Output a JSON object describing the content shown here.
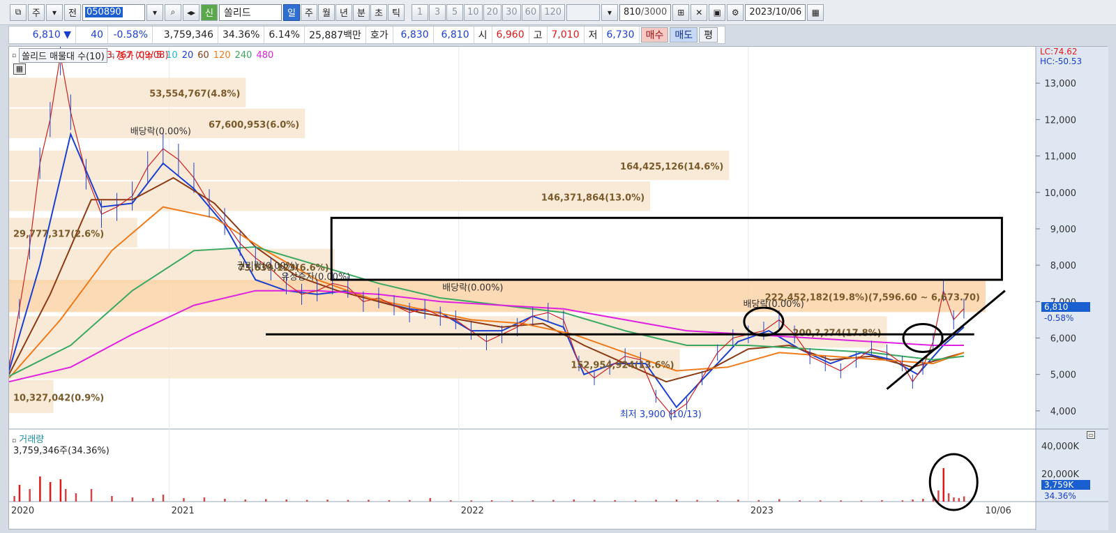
{
  "toolbar": {
    "type_label": "주",
    "prev_label": "전",
    "stock_code": "050890",
    "stock_name": "쏠리드",
    "credit_label": "신",
    "periods": [
      "일",
      "주",
      "월",
      "년",
      "분",
      "초",
      "틱"
    ],
    "selected_period": "일",
    "intervals": [
      "1",
      "3",
      "5",
      "10",
      "20",
      "30",
      "60",
      "120"
    ],
    "count_value": "810",
    "count_total": "/3000",
    "date": "2023/10/06"
  },
  "quote": {
    "price": "6,810",
    "direction": "▼",
    "change": "40",
    "change_rate": "-0.58%",
    "volume": "3,759,346",
    "volume_rate": "34.36%",
    "turnover": "6.14%",
    "amount": "25,887백만",
    "bid_label": "호가",
    "bid1": "6,830",
    "bid2": "6,810",
    "open_label": "시",
    "open": "6,960",
    "high_label": "고",
    "high": "7,010",
    "low_label": "저",
    "low": "6,730",
    "buy_label": "매수",
    "sell_label": "매도",
    "flat_label": "평"
  },
  "legend": {
    "indicator": "쏠리드 매물대 수(10)",
    "ma_label": "종가 지수",
    "periods": [
      {
        "p": "5",
        "color": "#e01818"
      },
      {
        "p": "10",
        "color": "#20b8c8"
      },
      {
        "p": "20",
        "color": "#1a3fd0"
      },
      {
        "p": "60",
        "color": "#8b3a14"
      },
      {
        "p": "120",
        "color": "#f07a18"
      },
      {
        "p": "240",
        "color": "#3aa860"
      },
      {
        "p": "480",
        "color": "#e020e0"
      }
    ]
  },
  "right_labels": {
    "lc": "LC:74.62",
    "hc": "HC:-50.53",
    "current_price": "6,810",
    "current_change": "-0.58%",
    "vol_current": "3,759K",
    "vol_rate": "34.36%"
  },
  "annotations": {
    "high": "최고 13,767 (09/08)",
    "low": "최저 3,900 (10/13)",
    "div1": "배당락(0.00%)",
    "div2": "배당락(0.00%)",
    "div3": "배당락(0.00%)",
    "rights": "권리락(0.00%)",
    "rights_issue": "유상증자(0.00%)"
  },
  "volume_section": {
    "label": "거래량",
    "info": "3,759,346주(34.36%)"
  },
  "chart_data": {
    "type": "bar",
    "title": "",
    "price_axis": {
      "ylim": [
        3500,
        14000
      ],
      "ticks": [
        "13,000",
        "12,000",
        "11,000",
        "10,000",
        "9,000",
        "8,000",
        "7,000",
        "6,000",
        "5,000",
        "4,000"
      ],
      "tick_values": [
        13000,
        12000,
        11000,
        10000,
        9000,
        8000,
        7000,
        6000,
        5000,
        4000
      ]
    },
    "volume_axis": {
      "ticks": [
        "40,000K",
        "20,000K"
      ],
      "tick_values": [
        40000,
        20000
      ]
    },
    "x_ticks": [
      {
        "label": "2020",
        "t": 0.0
      },
      {
        "label": "2021",
        "t": 0.156
      },
      {
        "label": "2022",
        "t": 0.438
      },
      {
        "label": "2023",
        "t": 0.72
      },
      {
        "label": "10/06",
        "t": 0.948
      }
    ],
    "volume_profile": [
      {
        "label": "53,554,767(4.8%)",
        "price_from": 12300,
        "price_to": 13150,
        "amount": 53554767,
        "pct": 4.8
      },
      {
        "label": "67,600,953(6.0%)",
        "price_from": 11450,
        "price_to": 12300,
        "amount": 67600953,
        "pct": 6.0
      },
      {
        "label": "164,425,126(14.6%)",
        "price_from": 10300,
        "price_to": 11150,
        "amount": 164425126,
        "pct": 14.6
      },
      {
        "label": "146,371,864(13.0%)",
        "price_from": 9450,
        "price_to": 10300,
        "amount": 146371864,
        "pct": 13.0
      },
      {
        "label": "29,777,317(2.6%)",
        "price_from": 8450,
        "price_to": 9300,
        "amount": 29777317,
        "pct": 2.6
      },
      {
        "label": "73,639,123(6.6%)",
        "price_from": 7450,
        "price_to": 8450,
        "amount": 73639123,
        "pct": 6.6
      },
      {
        "label": "222,452,182(19.8%)(7,596.60 ~ 6,673.70)",
        "price_from": 6673.7,
        "price_to": 7596.6,
        "amount": 222452182,
        "pct": 19.8,
        "highlight": true
      },
      {
        "label": "200,?,?74(17.8%)",
        "price_from": 5700,
        "price_to": 6600,
        "amount": 200000000,
        "pct": 17.8
      },
      {
        "label": "152,954,924(13.6%)",
        "price_from": 4850,
        "price_to": 5700,
        "amount": 152954924,
        "pct": 13.6
      },
      {
        "label": "10,327,042(0.9%)",
        "price_from": 3900,
        "price_to": 4850,
        "amount": 10327042,
        "pct": 0.9
      }
    ],
    "price_series": [
      [
        0.0,
        5200
      ],
      [
        0.01,
        6800
      ],
      [
        0.02,
        8500
      ],
      [
        0.03,
        10800
      ],
      [
        0.04,
        12000
      ],
      [
        0.05,
        13767
      ],
      [
        0.06,
        12200
      ],
      [
        0.075,
        10500
      ],
      [
        0.09,
        9400
      ],
      [
        0.105,
        9600
      ],
      [
        0.12,
        9900
      ],
      [
        0.135,
        10700
      ],
      [
        0.15,
        11200
      ],
      [
        0.165,
        10900
      ],
      [
        0.18,
        10400
      ],
      [
        0.195,
        9700
      ],
      [
        0.21,
        9200
      ],
      [
        0.225,
        8600
      ],
      [
        0.24,
        8200
      ],
      [
        0.255,
        7900
      ],
      [
        0.27,
        7500
      ],
      [
        0.285,
        7200
      ],
      [
        0.3,
        7300
      ],
      [
        0.315,
        7500
      ],
      [
        0.33,
        7400
      ],
      [
        0.345,
        7000
      ],
      [
        0.36,
        7100
      ],
      [
        0.375,
        6900
      ],
      [
        0.39,
        6700
      ],
      [
        0.405,
        6800
      ],
      [
        0.42,
        6600
      ],
      [
        0.435,
        6500
      ],
      [
        0.45,
        6200
      ],
      [
        0.465,
        5900
      ],
      [
        0.48,
        6100
      ],
      [
        0.495,
        6300
      ],
      [
        0.51,
        6600
      ],
      [
        0.525,
        6700
      ],
      [
        0.54,
        6500
      ],
      [
        0.555,
        5300
      ],
      [
        0.57,
        4900
      ],
      [
        0.585,
        5200
      ],
      [
        0.6,
        5500
      ],
      [
        0.615,
        5400
      ],
      [
        0.63,
        4400
      ],
      [
        0.645,
        3900
      ],
      [
        0.66,
        4200
      ],
      [
        0.675,
        4900
      ],
      [
        0.69,
        5600
      ],
      [
        0.705,
        6000
      ],
      [
        0.72,
        6100
      ],
      [
        0.735,
        6200
      ],
      [
        0.75,
        6500
      ],
      [
        0.765,
        6100
      ],
      [
        0.78,
        5500
      ],
      [
        0.795,
        5300
      ],
      [
        0.81,
        5100
      ],
      [
        0.825,
        5400
      ],
      [
        0.84,
        5700
      ],
      [
        0.855,
        5600
      ],
      [
        0.87,
        5300
      ],
      [
        0.88,
        4800
      ],
      [
        0.89,
        5200
      ],
      [
        0.9,
        5900
      ],
      [
        0.91,
        7300
      ],
      [
        0.92,
        6500
      ],
      [
        0.93,
        6810
      ]
    ],
    "ma_series": [
      {
        "name": "20",
        "color": "#1a3fd0",
        "points": [
          [
            0.0,
            5100
          ],
          [
            0.03,
            8000
          ],
          [
            0.06,
            11600
          ],
          [
            0.09,
            9600
          ],
          [
            0.12,
            9700
          ],
          [
            0.15,
            10800
          ],
          [
            0.18,
            10100
          ],
          [
            0.21,
            9100
          ],
          [
            0.24,
            7600
          ],
          [
            0.27,
            7300
          ],
          [
            0.3,
            7200
          ],
          [
            0.33,
            7300
          ],
          [
            0.36,
            7000
          ],
          [
            0.39,
            6800
          ],
          [
            0.42,
            6700
          ],
          [
            0.45,
            6200
          ],
          [
            0.48,
            6200
          ],
          [
            0.51,
            6600
          ],
          [
            0.54,
            6300
          ],
          [
            0.56,
            5000
          ],
          [
            0.59,
            5300
          ],
          [
            0.62,
            5300
          ],
          [
            0.65,
            4100
          ],
          [
            0.68,
            5000
          ],
          [
            0.71,
            5900
          ],
          [
            0.74,
            6200
          ],
          [
            0.77,
            5700
          ],
          [
            0.8,
            5300
          ],
          [
            0.83,
            5600
          ],
          [
            0.86,
            5400
          ],
          [
            0.885,
            5000
          ],
          [
            0.91,
            5800
          ],
          [
            0.93,
            6300
          ]
        ]
      },
      {
        "name": "60",
        "color": "#8b3a14",
        "points": [
          [
            0.0,
            5000
          ],
          [
            0.04,
            7200
          ],
          [
            0.08,
            9800
          ],
          [
            0.12,
            9800
          ],
          [
            0.16,
            10400
          ],
          [
            0.2,
            9700
          ],
          [
            0.24,
            8500
          ],
          [
            0.28,
            7700
          ],
          [
            0.32,
            7300
          ],
          [
            0.36,
            7000
          ],
          [
            0.4,
            6700
          ],
          [
            0.44,
            6500
          ],
          [
            0.48,
            6300
          ],
          [
            0.52,
            6400
          ],
          [
            0.56,
            5800
          ],
          [
            0.6,
            5300
          ],
          [
            0.64,
            4800
          ],
          [
            0.68,
            5100
          ],
          [
            0.72,
            5700
          ],
          [
            0.76,
            5800
          ],
          [
            0.8,
            5400
          ],
          [
            0.84,
            5500
          ],
          [
            0.88,
            5200
          ],
          [
            0.93,
            5600
          ]
        ]
      },
      {
        "name": "120",
        "color": "#f07a18",
        "points": [
          [
            0.0,
            4900
          ],
          [
            0.05,
            6500
          ],
          [
            0.1,
            8400
          ],
          [
            0.15,
            9600
          ],
          [
            0.2,
            9300
          ],
          [
            0.25,
            8400
          ],
          [
            0.3,
            7600
          ],
          [
            0.35,
            7100
          ],
          [
            0.4,
            6800
          ],
          [
            0.45,
            6500
          ],
          [
            0.5,
            6400
          ],
          [
            0.55,
            6100
          ],
          [
            0.6,
            5600
          ],
          [
            0.65,
            5100
          ],
          [
            0.7,
            5200
          ],
          [
            0.75,
            5600
          ],
          [
            0.8,
            5500
          ],
          [
            0.85,
            5400
          ],
          [
            0.9,
            5300
          ],
          [
            0.93,
            5600
          ]
        ]
      },
      {
        "name": "240",
        "color": "#3aa860",
        "points": [
          [
            0.0,
            4950
          ],
          [
            0.06,
            5800
          ],
          [
            0.12,
            7300
          ],
          [
            0.18,
            8400
          ],
          [
            0.24,
            8500
          ],
          [
            0.3,
            8000
          ],
          [
            0.36,
            7500
          ],
          [
            0.42,
            7100
          ],
          [
            0.48,
            6900
          ],
          [
            0.54,
            6700
          ],
          [
            0.6,
            6200
          ],
          [
            0.66,
            5800
          ],
          [
            0.72,
            5800
          ],
          [
            0.78,
            5700
          ],
          [
            0.84,
            5600
          ],
          [
            0.9,
            5400
          ],
          [
            0.93,
            5500
          ]
        ]
      },
      {
        "name": "480",
        "color": "#e020e0",
        "points": [
          [
            0.0,
            4800
          ],
          [
            0.06,
            5200
          ],
          [
            0.12,
            6100
          ],
          [
            0.18,
            6900
          ],
          [
            0.24,
            7300
          ],
          [
            0.3,
            7300
          ],
          [
            0.36,
            7200
          ],
          [
            0.42,
            7000
          ],
          [
            0.48,
            6900
          ],
          [
            0.54,
            6800
          ],
          [
            0.6,
            6500
          ],
          [
            0.66,
            6200
          ],
          [
            0.72,
            6100
          ],
          [
            0.78,
            6000
          ],
          [
            0.84,
            5900
          ],
          [
            0.9,
            5800
          ],
          [
            0.93,
            5800
          ]
        ]
      }
    ],
    "volume_series": [
      [
        0.005,
        4000
      ],
      [
        0.01,
        12000
      ],
      [
        0.02,
        9000
      ],
      [
        0.03,
        18000
      ],
      [
        0.04,
        14000
      ],
      [
        0.05,
        16000
      ],
      [
        0.055,
        9000
      ],
      [
        0.065,
        6000
      ],
      [
        0.08,
        9000
      ],
      [
        0.1,
        4000
      ],
      [
        0.12,
        3000
      ],
      [
        0.14,
        2500
      ],
      [
        0.15,
        5000
      ],
      [
        0.17,
        2500
      ],
      [
        0.19,
        3000
      ],
      [
        0.21,
        2000
      ],
      [
        0.23,
        1500
      ],
      [
        0.25,
        1800
      ],
      [
        0.27,
        1500
      ],
      [
        0.29,
        1200
      ],
      [
        0.31,
        1400
      ],
      [
        0.33,
        1200
      ],
      [
        0.35,
        1300
      ],
      [
        0.37,
        1000
      ],
      [
        0.39,
        1100
      ],
      [
        0.41,
        2500
      ],
      [
        0.43,
        1000
      ],
      [
        0.45,
        900
      ],
      [
        0.47,
        1000
      ],
      [
        0.49,
        900
      ],
      [
        0.51,
        1000
      ],
      [
        0.53,
        1200
      ],
      [
        0.55,
        1500
      ],
      [
        0.57,
        1200
      ],
      [
        0.59,
        1000
      ],
      [
        0.61,
        900
      ],
      [
        0.63,
        1300
      ],
      [
        0.65,
        1500
      ],
      [
        0.67,
        1200
      ],
      [
        0.69,
        1000
      ],
      [
        0.71,
        1400
      ],
      [
        0.73,
        1100
      ],
      [
        0.75,
        1800
      ],
      [
        0.77,
        1000
      ],
      [
        0.79,
        900
      ],
      [
        0.81,
        900
      ],
      [
        0.83,
        800
      ],
      [
        0.85,
        1000
      ],
      [
        0.87,
        900
      ],
      [
        0.88,
        1500
      ],
      [
        0.89,
        2000
      ],
      [
        0.9,
        3500
      ],
      [
        0.905,
        8000
      ],
      [
        0.91,
        24000
      ],
      [
        0.915,
        6000
      ],
      [
        0.92,
        3000
      ],
      [
        0.925,
        2500
      ],
      [
        0.93,
        3759
      ]
    ],
    "drawings": {
      "resistance_box": {
        "price_from": 7600,
        "price_to": 9300,
        "t_from": 0.314,
        "t_to": 0.967
      },
      "support_line": {
        "price": 6100,
        "t_from": 0.25,
        "t_to": 0.94
      },
      "trend_line": {
        "p1": [
          0.855,
          4600
        ],
        "p2": [
          0.97,
          7300
        ]
      },
      "circles": [
        {
          "t": 0.735,
          "price": 6450
        },
        {
          "t": 0.89,
          "price": 6000
        }
      ],
      "volume_circle": {
        "t": 0.92,
        "vol": 14000
      }
    }
  }
}
